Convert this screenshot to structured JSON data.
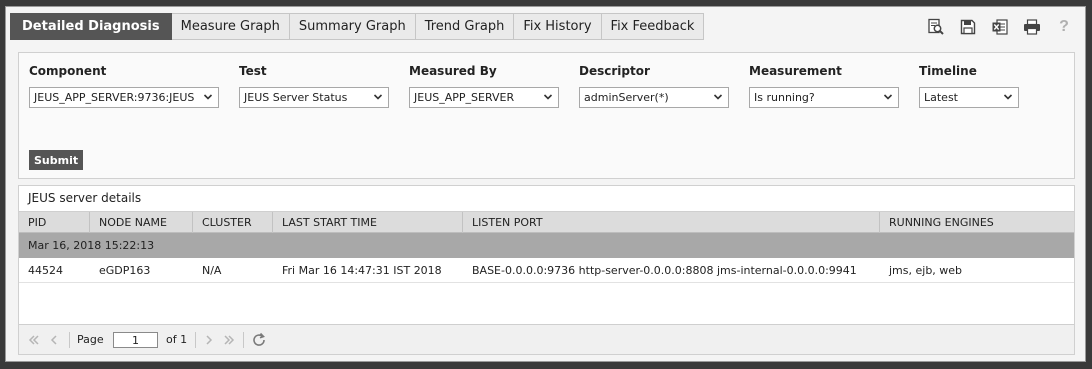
{
  "tabs": [
    {
      "label": "Detailed Diagnosis",
      "active": true
    },
    {
      "label": "Measure Graph",
      "active": false
    },
    {
      "label": "Summary Graph",
      "active": false
    },
    {
      "label": "Trend Graph",
      "active": false
    },
    {
      "label": "Fix History",
      "active": false
    },
    {
      "label": "Fix Feedback",
      "active": false
    }
  ],
  "toolbar": {
    "icons": [
      "search-document-icon",
      "save-icon",
      "excel-export-icon",
      "print-icon",
      "help-icon"
    ],
    "help_glyph": "?"
  },
  "filters": {
    "component": {
      "label": "Component",
      "value": "JEUS_APP_SERVER:9736:JEUS"
    },
    "test": {
      "label": "Test",
      "value": "JEUS Server Status"
    },
    "measured_by": {
      "label": "Measured By",
      "value": "JEUS_APP_SERVER"
    },
    "descriptor": {
      "label": "Descriptor",
      "value": "adminServer(*)"
    },
    "measurement": {
      "label": "Measurement",
      "value": "Is running?"
    },
    "timeline": {
      "label": "Timeline",
      "value": "Latest"
    },
    "submit_label": "Submit"
  },
  "grid": {
    "title": "JEUS server details",
    "columns": [
      "PID",
      "NODE NAME",
      "CLUSTER",
      "LAST START TIME",
      "LISTEN PORT",
      "RUNNING ENGINES"
    ],
    "group_label": "Mar 16, 2018 15:22:13",
    "rows": [
      [
        "44524",
        "eGDP163",
        "N/A",
        "Fri Mar 16 14:47:31 IST 2018",
        "BASE-0.0.0.0:9736 http-server-0.0.0.0:8808 jms-internal-0.0.0.0:9941",
        "jms, ejb, web"
      ]
    ]
  },
  "pager": {
    "page_label": "Page",
    "page_value": "1",
    "of_label": "of 1"
  },
  "colors": {
    "active_tab": "#555555",
    "group_row": "#a8a8a8",
    "header_row": "#dcdcdc",
    "background": "#3a3a3a"
  }
}
